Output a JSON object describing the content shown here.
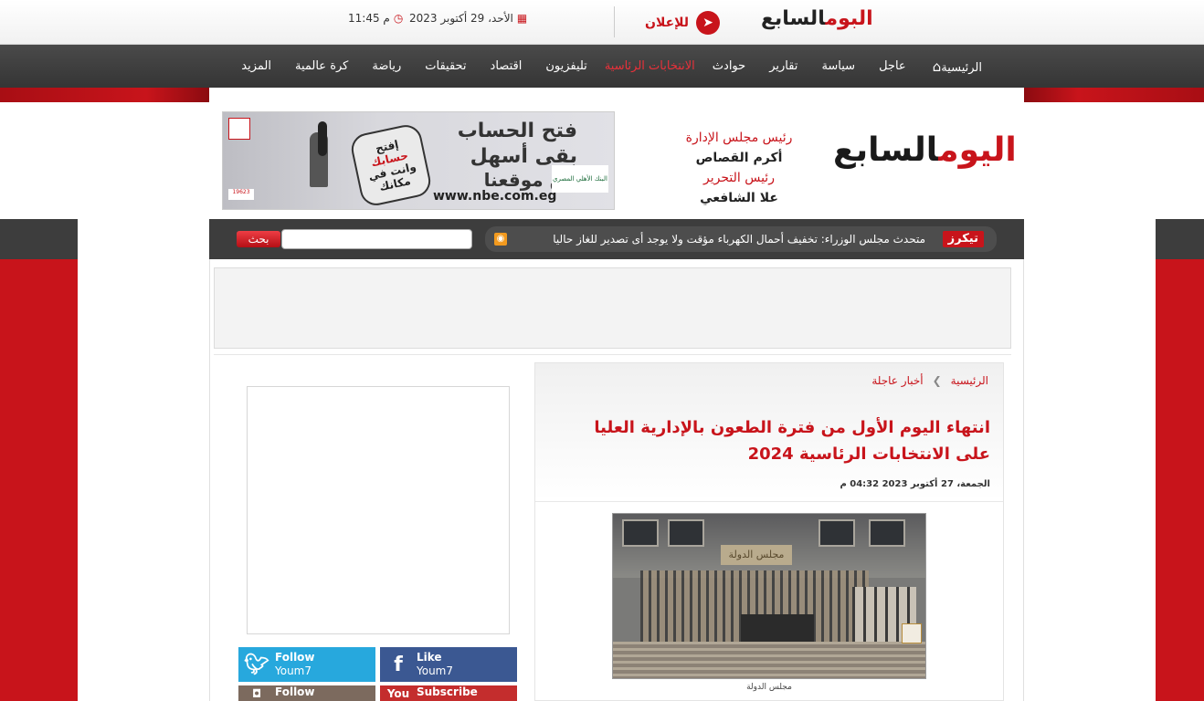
{
  "topbar": {
    "logo_red": "البوم",
    "logo_dark": "السابع",
    "ad_label": "للإعلان",
    "date": "الأحد، 29 أكتوبر 2023",
    "time": "11:45 م"
  },
  "nav": {
    "items": [
      {
        "label": "الرئيسية"
      },
      {
        "label": "عاجل"
      },
      {
        "label": "سياسة"
      },
      {
        "label": "تقارير"
      },
      {
        "label": "حوادث"
      },
      {
        "label": "الانتخابات الرئاسية"
      },
      {
        "label": "تليفزيون"
      },
      {
        "label": "اقتصاد"
      },
      {
        "label": "تحقيقات"
      },
      {
        "label": "رياضة"
      },
      {
        "label": "كرة عالمية"
      },
      {
        "label": "المزيد"
      }
    ]
  },
  "masthead": {
    "logo_red": "اليوم",
    "logo_dark": "السابع",
    "chairman_role": "رئيس مجلس الإدارة",
    "chairman_name": "أكرم القصاص",
    "editor_role": "رئيس التحرير",
    "editor_name": "علا الشافعي"
  },
  "banner": {
    "line1": "فتح الحساب",
    "line2": "بقى أسهل",
    "line3": "من موقعنا",
    "url": "www.nbe.com.eg",
    "bubble_top": "إفتح",
    "bubble_mid": "حسابك",
    "bubble_bot": "وانت في مكانك",
    "bank": "البنك الأهلي المصري",
    "hotline": "19623"
  },
  "ticker": {
    "label": "تيكرز",
    "text": "متحدث مجلس الوزراء: تخفيف أحمال الكهرباء مؤقت ولا يوجد أى تصدير للغاز حاليا",
    "search_placeholder": "",
    "search_button": "بحث"
  },
  "article": {
    "breadcrumb": [
      "الرئيسية",
      "أخبار عاجلة"
    ],
    "title": "انتهاء اليوم الأول من فترة الطعون بالإدارية العليا على الانتخابات الرئاسية 2024",
    "date": "الجمعة، 27 أكتوبر 2023 04:32 م",
    "photo_plaque": "مجلس الدولة",
    "caption": "مجلس الدولة"
  },
  "social": {
    "twitter": {
      "action": "Follow",
      "account": "Youm7"
    },
    "facebook": {
      "action": "Like",
      "account": "Youm7"
    },
    "instagram": {
      "action": "Follow"
    },
    "youtube": {
      "action": "Subscribe",
      "icon_text": "You"
    }
  },
  "colors": {
    "brand_red": "#c8141b",
    "nav_bg": "#3d3d3d",
    "twitter": "#27a8dd",
    "facebook": "#3b5892",
    "youtube": "#c42d2d"
  }
}
